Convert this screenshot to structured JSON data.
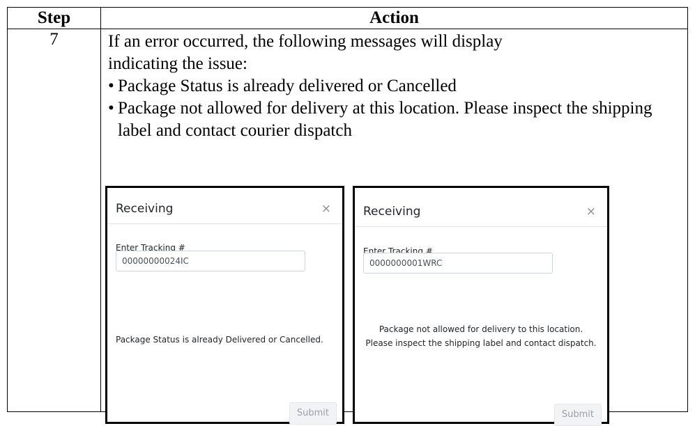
{
  "table": {
    "headers": {
      "step": "Step",
      "action": "Action"
    },
    "row": {
      "step": "7",
      "intro_line1": "If an error occurred, the following messages will display",
      "intro_line2": "indicating the issue:",
      "bullets": [
        "Package Status is already delivered or Cancelled",
        "Package not allowed for delivery at this location. Please inspect the shipping label and contact courier dispatch"
      ]
    }
  },
  "screenshots": [
    {
      "title": "Receiving",
      "close": "×",
      "field_label": "Enter Tracking #",
      "tracking_value": "00000000024IC",
      "message_lines": [
        "Package Status is already Delivered or Cancelled."
      ],
      "submit": "Submit"
    },
    {
      "title": "Receiving",
      "close": "×",
      "field_label": "Enter Tracking #",
      "tracking_value": "0000000001WRC",
      "message_lines": [
        "Package not allowed for delivery to this location.",
        "Please inspect the shipping label and contact dispatch."
      ],
      "submit": "Submit"
    }
  ]
}
